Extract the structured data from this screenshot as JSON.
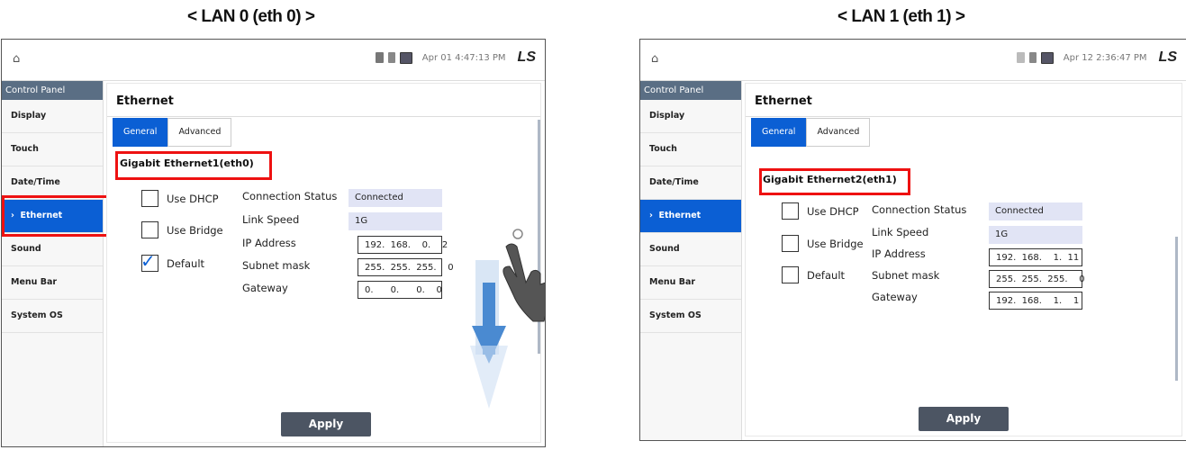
{
  "captions": {
    "left": "< LAN 0 (eth 0) >",
    "right": "< LAN 1 (eth 1) >"
  },
  "colors": {
    "accent": "#0b5fd4",
    "highlight": "#ee1111",
    "apply_button": "#4c5563",
    "sidebar_header": "#5a6e84",
    "readonly_field": "#e1e4f5",
    "arrow": "#4a8ad1"
  },
  "screens": [
    {
      "status": {
        "clock": "Apr 01 4:47:13 PM",
        "logo": "LS"
      },
      "sidebar": {
        "header": "Control Panel",
        "items": [
          "Display",
          "Touch",
          "Date/Time",
          "Ethernet",
          "Sound",
          "Menu Bar",
          "System OS"
        ],
        "selected": "Ethernet"
      },
      "main": {
        "title": "Ethernet",
        "tabs": [
          "General",
          "Advanced"
        ],
        "interface_name": "Gigabit Ethernet1(eth0)",
        "checkboxes": [
          {
            "label": "Use DHCP",
            "checked": false
          },
          {
            "label": "Use Bridge",
            "checked": false
          },
          {
            "label": "Default",
            "checked": true
          }
        ],
        "fields": [
          {
            "label": "Connection Status",
            "value": "Connected"
          },
          {
            "label": "Link Speed",
            "value": "1G"
          },
          {
            "label": "IP Address",
            "value": "192.  168.    0.    2"
          },
          {
            "label": "Subnet mask",
            "value": "255.  255.  255.    0"
          },
          {
            "label": "Gateway",
            "value": "0.      0.      0.    0"
          }
        ],
        "apply_label": "Apply"
      },
      "annotation": {
        "gesture": "swipe-down",
        "icons": [
          "hand-pointer-icon",
          "down-arrow-icon"
        ]
      }
    },
    {
      "status": {
        "clock": "Apr 12 2:36:47 PM",
        "logo": "LS"
      },
      "sidebar": {
        "header": "Control Panel",
        "items": [
          "Display",
          "Touch",
          "Date/Time",
          "Ethernet",
          "Sound",
          "Menu Bar",
          "System OS"
        ],
        "selected": "Ethernet"
      },
      "main": {
        "title": "Ethernet",
        "tabs": [
          "General",
          "Advanced"
        ],
        "interface_name": "Gigabit Ethernet2(eth1)",
        "checkboxes": [
          {
            "label": "Use DHCP",
            "checked": false
          },
          {
            "label": "Use Bridge",
            "checked": false
          },
          {
            "label": "Default",
            "checked": false
          }
        ],
        "fields": [
          {
            "label": "Connection Status",
            "value": "Connected"
          },
          {
            "label": "Link Speed",
            "value": "1G"
          },
          {
            "label": "IP Address",
            "value": "192.  168.    1.  11"
          },
          {
            "label": "Subnet mask",
            "value": "255.  255.  255.    0"
          },
          {
            "label": "Gateway",
            "value": "192.  168.    1.    1"
          }
        ],
        "apply_label": "Apply"
      }
    }
  ]
}
